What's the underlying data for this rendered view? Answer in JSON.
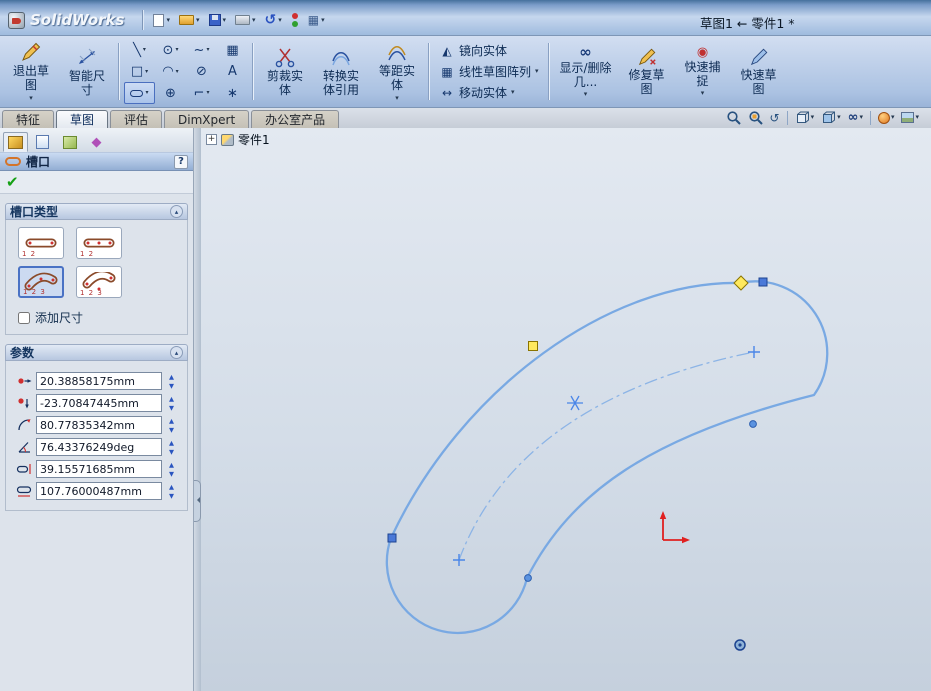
{
  "titlebar": {
    "app_name": "SolidWorks",
    "doc_title": "草图1 ← 零件1 *"
  },
  "glyphs": {
    "caret_down": "▾",
    "spin_up": "▲",
    "spin_down": "▼",
    "check": "✔",
    "question": "?",
    "expand_plus": "+",
    "collapse_up": "▴",
    "line_tool": "╲",
    "circle_tool": "⊙",
    "spline_tool": "~",
    "grid_tool": "▦",
    "rect_tool": "□",
    "arc_tool": "◠",
    "ellipse_tool": "⊘",
    "text_tool": "A",
    "point_tool": "⊕",
    "fillet_tool": "⌐",
    "star_tool": "∗",
    "mirror_tool": "◭",
    "pattern_tool": "▦",
    "move_tool": "↔",
    "glasses_tool": "∞",
    "snap_tool": "◉",
    "undo": "↺",
    "rotate_view": "↺",
    "menu_grid": "▦"
  },
  "ribbon": {
    "exit_sketch": "退出草图",
    "smart_dimension": "智能尺寸",
    "trim": "剪裁实体",
    "convert": "转换实体引用",
    "offset": "等距实体",
    "mirror": "镜向实体",
    "linear_pattern": "线性草图阵列",
    "move": "移动实体",
    "display_delete": "显示/删除几...",
    "repair": "修复草图",
    "quick_snap": "快速捕捉",
    "rapid_sketch": "快速草图"
  },
  "tabs": {
    "features": "特征",
    "sketch": "草图",
    "evaluate": "评估",
    "dimxpert": "DimXpert",
    "office": "办公室产品"
  },
  "viewport": {
    "feature_tree_root": "零件1"
  },
  "panel": {
    "title": "槽口",
    "slot_type_label": "槽口类型",
    "add_dimension_label": "添加尺寸",
    "parameters_label": "参数",
    "slot_types": [
      {
        "name": "straight-slot",
        "digits": "1 2"
      },
      {
        "name": "centerpoint-straight-slot",
        "digits": "1 2"
      },
      {
        "name": "three-point-arc-slot",
        "digits": "1 2 3"
      },
      {
        "name": "centerpoint-arc-slot",
        "digits": "1 2 3"
      }
    ],
    "parameters": [
      {
        "name": "center-x",
        "value": "20.38858175mm"
      },
      {
        "name": "center-y",
        "value": "-23.70847445mm"
      },
      {
        "name": "radius",
        "value": "80.77835342mm"
      },
      {
        "name": "angle",
        "value": "76.43376249deg"
      },
      {
        "name": "slot-width",
        "value": "39.15571685mm"
      },
      {
        "name": "slot-length",
        "value": "107.76000487mm"
      }
    ]
  }
}
